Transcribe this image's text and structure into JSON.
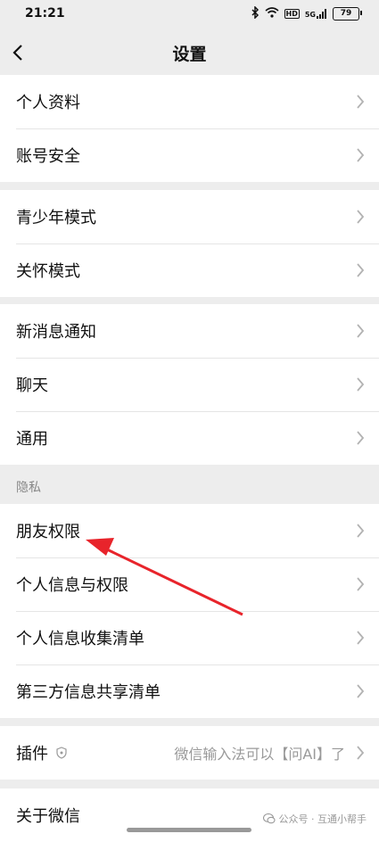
{
  "status_bar": {
    "time": "21:21",
    "network": "HD",
    "signal": "5G",
    "battery": "79"
  },
  "header": {
    "title": "设置"
  },
  "groups": [
    {
      "items": [
        {
          "label": "个人资料"
        },
        {
          "label": "账号安全"
        }
      ]
    },
    {
      "items": [
        {
          "label": "青少年模式"
        },
        {
          "label": "关怀模式"
        }
      ]
    },
    {
      "items": [
        {
          "label": "新消息通知"
        },
        {
          "label": "聊天"
        },
        {
          "label": "通用"
        }
      ]
    },
    {
      "items": [
        {
          "label": "朋友权限"
        },
        {
          "label": "个人信息与权限"
        },
        {
          "label": "个人信息收集清单"
        },
        {
          "label": "第三方信息共享清单"
        }
      ]
    },
    {
      "items": [
        {
          "label": "插件",
          "value": "微信输入法可以【问AI】了"
        }
      ]
    },
    {
      "items": [
        {
          "label": "关于微信"
        }
      ]
    }
  ],
  "privacy_section_label": "隐私",
  "watermark": "公众号 · 互通小帮手",
  "colors": {
    "annotation_arrow": "#e8242b",
    "background": "#ededed"
  }
}
